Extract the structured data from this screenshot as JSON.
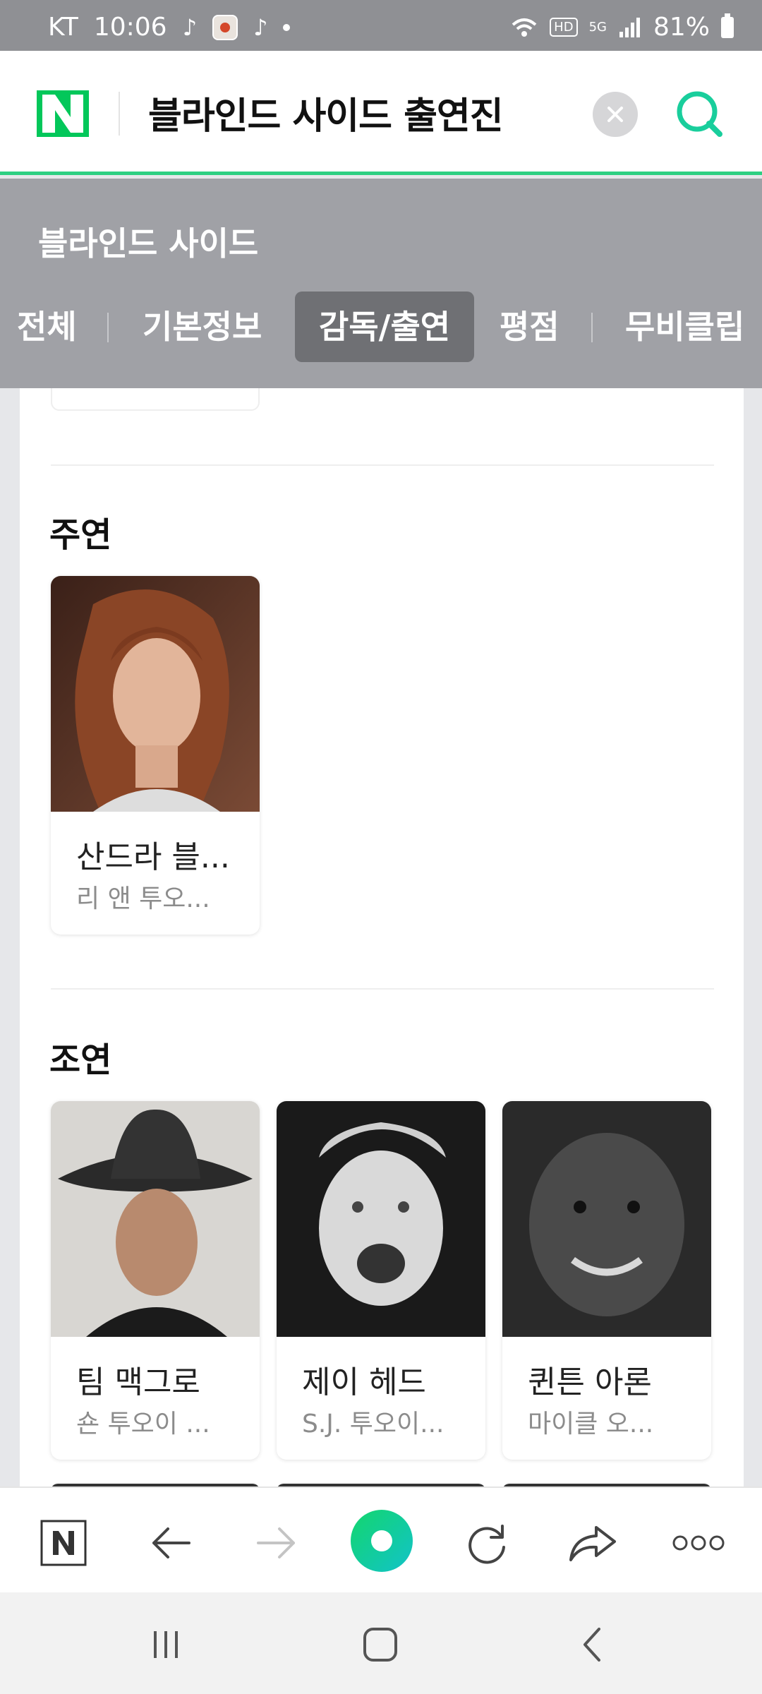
{
  "status_bar": {
    "carrier": "KT",
    "time": "10:06",
    "network": "5G",
    "hd": "HD",
    "battery": "81%"
  },
  "search": {
    "query": "블라인드 사이드 출연진"
  },
  "movie": {
    "title": "블라인드 사이드"
  },
  "tabs": [
    {
      "label": "전체",
      "active": false
    },
    {
      "label": "기본정보",
      "active": false
    },
    {
      "label": "감독/출연",
      "active": true
    },
    {
      "label": "평점",
      "active": false
    },
    {
      "label": "무비클립",
      "active": false
    }
  ],
  "sections": {
    "lead": {
      "heading": "주연",
      "people": [
        {
          "name": "산드라 블...",
          "role": "리 앤 투오..."
        }
      ]
    },
    "supporting": {
      "heading": "조연",
      "people": [
        {
          "name": "팀 맥그로",
          "role": "숀 투오이 ..."
        },
        {
          "name": "제이 헤드",
          "role": "S.J. 투오이..."
        },
        {
          "name": "퀸튼 아론",
          "role": "마이클 오..."
        }
      ]
    }
  },
  "colors": {
    "naver_green": "#03c75a",
    "accent_green": "#2ecf82",
    "overlay_gray": "#a0a1a6",
    "active_tab": "#6f7074"
  },
  "toolbar": {
    "icons": [
      "naver-home-icon",
      "back-arrow-icon",
      "forward-arrow-icon",
      "green-dot-icon",
      "refresh-icon",
      "share-icon",
      "more-icon"
    ]
  }
}
